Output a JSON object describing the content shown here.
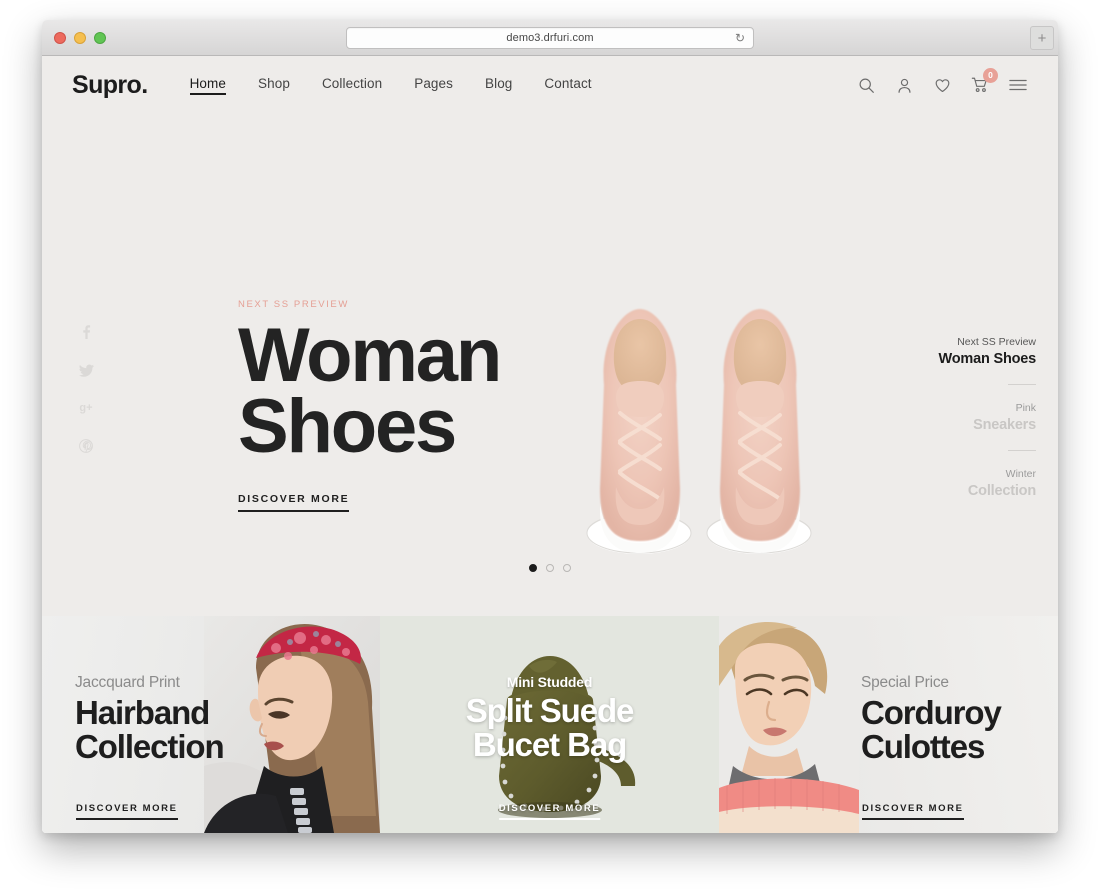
{
  "browser": {
    "url": "demo3.drfuri.com",
    "reload_icon": "reload-icon",
    "newtab_label": "+"
  },
  "header": {
    "logo": "Supro.",
    "nav": [
      {
        "label": "Home",
        "active": true
      },
      {
        "label": "Shop",
        "active": false
      },
      {
        "label": "Collection",
        "active": false
      },
      {
        "label": "Pages",
        "active": false
      },
      {
        "label": "Blog",
        "active": false
      },
      {
        "label": "Contact",
        "active": false
      }
    ],
    "icons": [
      {
        "name": "search-icon"
      },
      {
        "name": "user-account-icon"
      },
      {
        "name": "wishlist-heart-icon"
      },
      {
        "name": "shopping-cart-icon",
        "badge": "0"
      },
      {
        "name": "hamburger-menu-icon"
      }
    ],
    "cart_badge_color": "#e8a197"
  },
  "hero": {
    "eyebrow": "NEXT SS PREVIEW",
    "title_line1": "Woman",
    "title_line2": "Shoes",
    "cta": "DISCOVER MORE",
    "background_color": "#eeecea",
    "accent_color": "#e5a095",
    "product_image": "pink-fuzzy-sneakers-pair",
    "social": [
      {
        "name": "facebook-icon",
        "glyph": "f"
      },
      {
        "name": "twitter-icon",
        "glyph": "t"
      },
      {
        "name": "google-plus-icon",
        "glyph": "g+"
      },
      {
        "name": "pinterest-icon",
        "glyph": "p"
      }
    ],
    "slides": [
      {
        "sub": "Next SS Preview",
        "main": "Woman Shoes",
        "active": true
      },
      {
        "sub": "Pink",
        "main": "Sneakers",
        "active": false
      },
      {
        "sub": "Winter",
        "main": "Collection",
        "active": false
      }
    ],
    "dots": [
      {
        "active": true
      },
      {
        "active": false
      },
      {
        "active": false
      }
    ]
  },
  "cards": [
    {
      "sub": "Jaccquard Print",
      "title_line1": "Hairband",
      "title_line2": "Collection",
      "cta": "DISCOVER MORE",
      "photo": "woman-with-floral-hairband"
    },
    {
      "sub": "Mini Studded",
      "title_line1": "Split Suede",
      "title_line2": "Bucet Bag",
      "cta": "DISCOVER MORE",
      "photo": "olive-studded-bucket-bag"
    },
    {
      "sub": "Special Price",
      "title_line1": "Corduroy",
      "title_line2": "Culottes",
      "cta": "DISCOVER MORE",
      "photo": "woman-in-pink-striped-sweater"
    }
  ]
}
